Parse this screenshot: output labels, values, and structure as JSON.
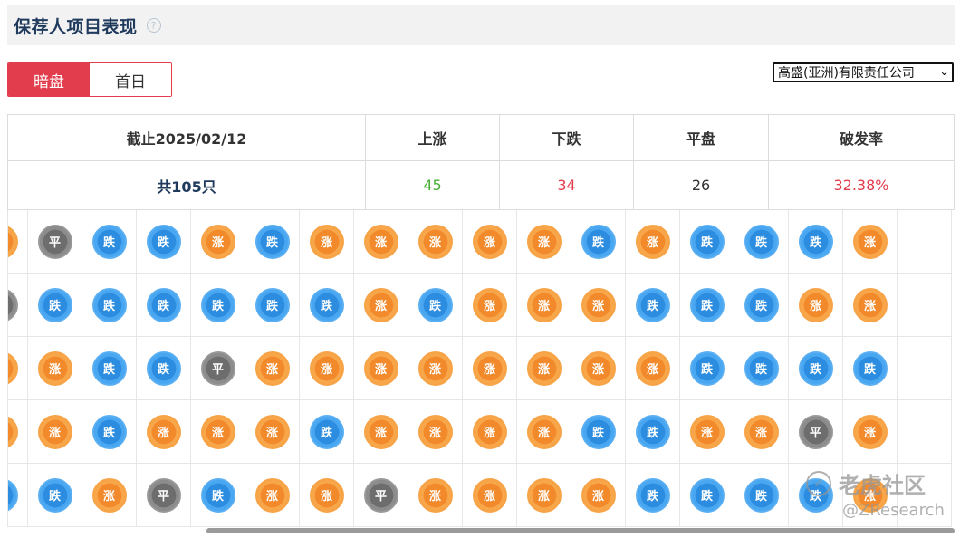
{
  "header": {
    "title": "保荐人项目表现",
    "help_icon": "?"
  },
  "tabs": [
    {
      "label": "暗盘",
      "active": true
    },
    {
      "label": "首日",
      "active": false
    }
  ],
  "sponsor_select": {
    "value": "高盛(亚洲)有限责任公司"
  },
  "summary": {
    "headers": {
      "date": "截止2025/02/12",
      "up": "上涨",
      "down": "下跌",
      "flat": "平盘",
      "break_rate": "破发率"
    },
    "values": {
      "total": "共105只",
      "up": "45",
      "down": "34",
      "flat": "26",
      "break_rate": "32.38%"
    }
  },
  "badge_labels": {
    "up": "涨",
    "down": "跌",
    "flat": "平"
  },
  "colors": {
    "up": "#f28a2c",
    "down": "#2c8de0",
    "flat": "#6d6d6d",
    "accent": "#e23d4d",
    "rise_text": "#44b033"
  },
  "grid": [
    [
      "up",
      "flat",
      "down",
      "down",
      "up",
      "down",
      "up",
      "up",
      "up",
      "up",
      "up",
      "down",
      "up",
      "down",
      "down",
      "down",
      "up"
    ],
    [
      "flat",
      "down",
      "down",
      "down",
      "down",
      "down",
      "down",
      "up",
      "down",
      "up",
      "up",
      "up",
      "down",
      "down",
      "down",
      "up",
      "up"
    ],
    [
      "up",
      "up",
      "down",
      "down",
      "flat",
      "up",
      "up",
      "up",
      "up",
      "up",
      "up",
      "up",
      "up",
      "down",
      "down",
      "down",
      "down"
    ],
    [
      "up",
      "up",
      "down",
      "up",
      "up",
      "up",
      "down",
      "up",
      "up",
      "up",
      "up",
      "down",
      "down",
      "up",
      "up",
      "flat",
      "up"
    ],
    [
      "down",
      "down",
      "up",
      "flat",
      "down",
      "up",
      "up",
      "flat",
      "up",
      "up",
      "up",
      "up",
      "down",
      "down",
      "down",
      "down",
      "up"
    ]
  ],
  "watermark": {
    "brand": "老虎社区",
    "handle": "@ZResearch"
  }
}
